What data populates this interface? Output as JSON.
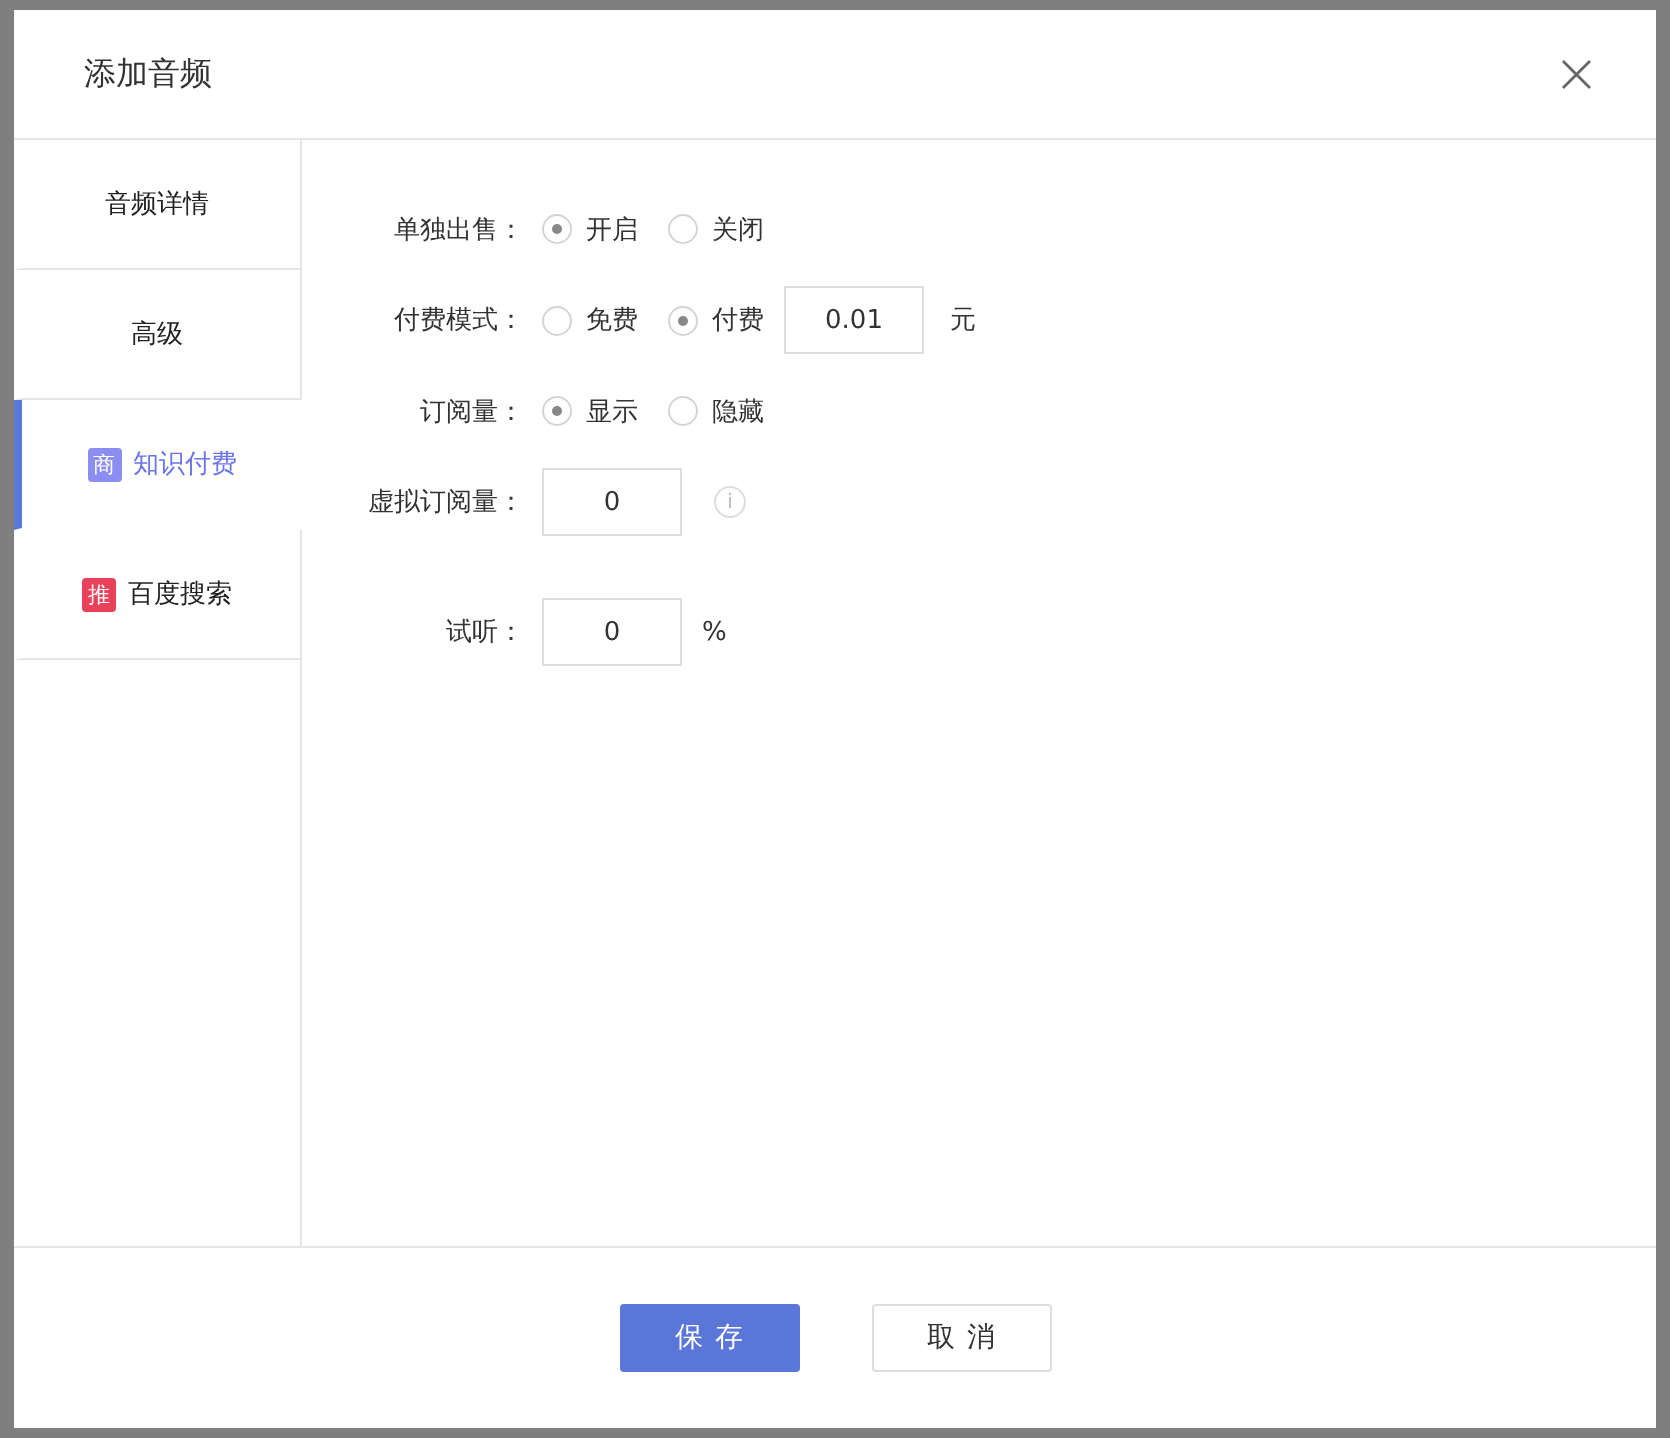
{
  "dialog": {
    "title": "添加音频",
    "close": "×"
  },
  "sidebar": {
    "items": [
      {
        "label": "音频详情",
        "selected": false
      },
      {
        "label": "高级",
        "selected": false
      },
      {
        "label": "知识付费",
        "selected": true,
        "badge": "商",
        "color": "#8b8ef0"
      },
      {
        "label": "百度搜索",
        "selected": false,
        "badge": "推",
        "color": "#e8415a"
      }
    ]
  },
  "form": [
    {
      "kind": "radio",
      "label": "单独出售：",
      "options": [
        {
          "label": "开启",
          "selected": true
        },
        {
          "label": "关闭",
          "selected": false
        }
      ]
    },
    {
      "kind": "radio",
      "label": "付费模式：",
      "options": [
        {
          "label": "免费",
          "selected": false
        },
        {
          "label": "付费",
          "selected": true
        }
      ],
      "value": "0.01",
      "unit": "元"
    },
    {
      "kind": "radio",
      "label": "订阅量：",
      "options": [
        {
          "label": "显示",
          "selected": true
        },
        {
          "label": "隐藏",
          "selected": false
        }
      ]
    },
    {
      "kind": "input",
      "label": "虚拟订阅量：",
      "value": "0",
      "info": "i"
    },
    {
      "kind": "input",
      "label": "试听：",
      "value": "0",
      "unit": "%"
    }
  ],
  "buttons": [
    {
      "label": "保存",
      "kind": "primary"
    },
    {
      "label": "取消",
      "kind": "default"
    }
  ]
}
